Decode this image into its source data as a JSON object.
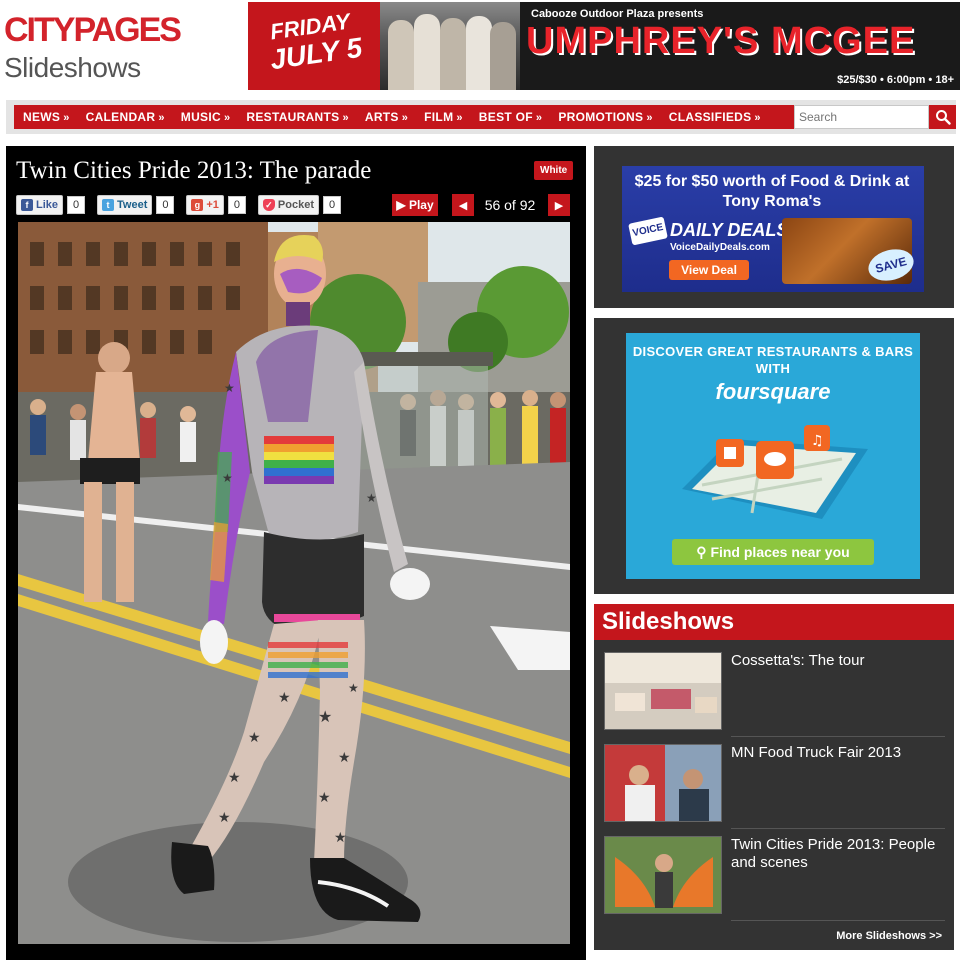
{
  "header": {
    "logo_text": "CITYPAGES",
    "section_title": "Slideshows",
    "ad": {
      "date_line1": "FRIDAY",
      "date_line2": "JULY 5",
      "presenter": "Cabooze Outdoor Plaza presents",
      "headliner": "UMPHREY'S MCGEE",
      "details": "$25/$30 • 6:00pm • 18+"
    }
  },
  "nav": {
    "items": [
      {
        "label": "NEWS"
      },
      {
        "label": "CALENDAR"
      },
      {
        "label": "MUSIC"
      },
      {
        "label": "RESTAURANTS"
      },
      {
        "label": "ARTS"
      },
      {
        "label": "FILM"
      },
      {
        "label": "BEST OF"
      },
      {
        "label": "PROMOTIONS"
      },
      {
        "label": "CLASSIFIEDS"
      }
    ],
    "chevron": "»",
    "search_placeholder": "Search",
    "search_icon": "search-icon"
  },
  "slideshow": {
    "title": "Twin Cities Pride 2013: The parade",
    "theme_button": "White",
    "share": {
      "facebook": {
        "label": "Like",
        "count": "0"
      },
      "twitter": {
        "label": "Tweet",
        "count": "0"
      },
      "google": {
        "label": "+1",
        "count": "0"
      },
      "pocket": {
        "label": "Pocket",
        "count": "0"
      }
    },
    "play_label": "▶ Play",
    "current": "56",
    "total": "92",
    "counter_text": "56 of 92"
  },
  "ads": {
    "tony_romas": {
      "headline": "$25 for $50 worth of Food & Drink at Tony Roma's",
      "badge": "VOICE",
      "brand": "DAILY DEALS",
      "url": "VoiceDailyDeals.com",
      "button": "View Deal",
      "save_badge": "SAVE 50%"
    },
    "foursquare": {
      "headline": "DISCOVER GREAT RESTAURANTS & BARS WITH",
      "brand": "foursquare",
      "button": "Find places near you"
    }
  },
  "sidebar": {
    "header": "Slideshows",
    "items": [
      {
        "label": "Cossetta's: The tour"
      },
      {
        "label": "MN Food Truck Fair 2013"
      },
      {
        "label": "Twin Cities Pride 2013: People and scenes"
      }
    ],
    "more_link": "More Slideshows >>"
  },
  "colors": {
    "brand_red": "#c4161c",
    "panel_dark": "#333333",
    "photo_bg": "#000000"
  }
}
